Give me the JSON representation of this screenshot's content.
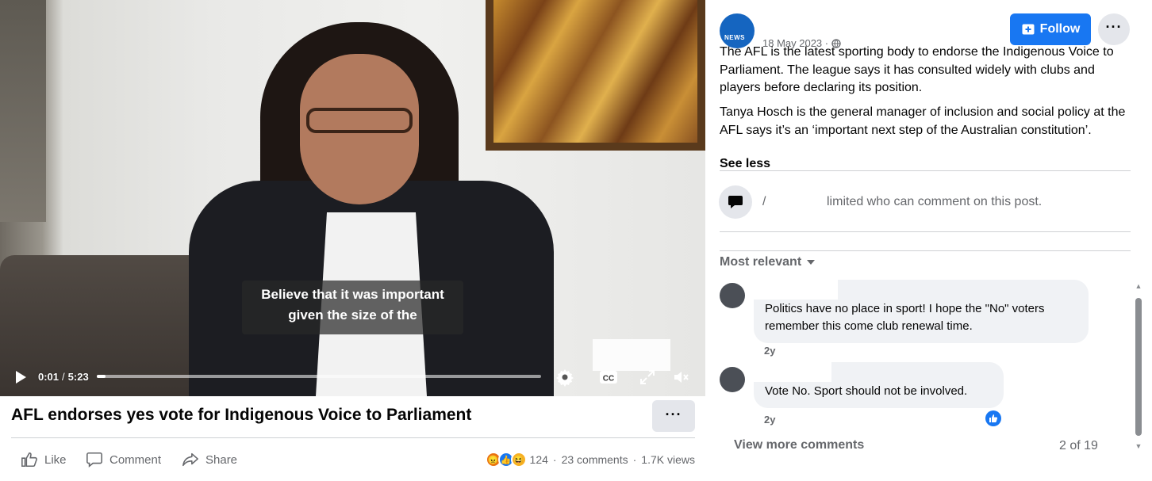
{
  "video": {
    "subtitle_line1": "Believe that it was important",
    "subtitle_line2": "given the size of the",
    "current_time": "0:01",
    "time_separator": "/",
    "duration": "5:23",
    "progress_fraction": 0.003
  },
  "post": {
    "title": "AFL endorses yes vote for Indigenous Voice to Parliament",
    "more_label": "···",
    "actions": {
      "like": "Like",
      "comment": "Comment",
      "share": "Share"
    },
    "reactions": [
      "angry",
      "like",
      "haha"
    ],
    "reaction_count": "124",
    "comments_count": "23 comments",
    "views_count": "1.7K views",
    "separator": "·"
  },
  "panel": {
    "avatar_text": "NEWS",
    "date": "18 May 2023 ·",
    "follow_label": "Follow",
    "more_label": "···",
    "paragraph1": "The AFL is the latest sporting body to endorse the Indigenous Voice to Parliament. The league says it has consulted widely with clubs and players before declaring its position.",
    "paragraph2": "Tanya Hosch is the general manager of inclusion and social policy at the AFL says it’s an ‘important next step of the Australian constitution’.",
    "see_less": "See less",
    "limit_prefix": "/",
    "limit_text": "limited who can comment on this post.",
    "sort_label": "Most relevant",
    "comments": [
      {
        "text": "Politics have no place in sport! I hope the \"No\" voters remember this come club renewal time.",
        "time": "2y"
      },
      {
        "text": "Vote No. Sport should not be involved.",
        "time": "2y"
      }
    ],
    "view_more": "View more comments",
    "count": "2 of 19"
  },
  "colors": {
    "brand_blue": "#1877f2",
    "secondary_text": "#65676b",
    "bubble_bg": "#f0f2f5",
    "button_gray": "#e4e6eb"
  },
  "icons": {
    "play": "play-icon",
    "settings": "gear-icon",
    "captions": "cc-icon",
    "fullscreen": "expand-icon",
    "volume": "volume-muted-icon",
    "like": "thumbs-up-icon",
    "comment": "speech-bubble-icon",
    "share": "share-arrow-icon",
    "follow": "follow-plus-icon",
    "globe": "globe-icon",
    "chat": "chat-bubble-icon",
    "chevron": "chevron-down-icon"
  }
}
